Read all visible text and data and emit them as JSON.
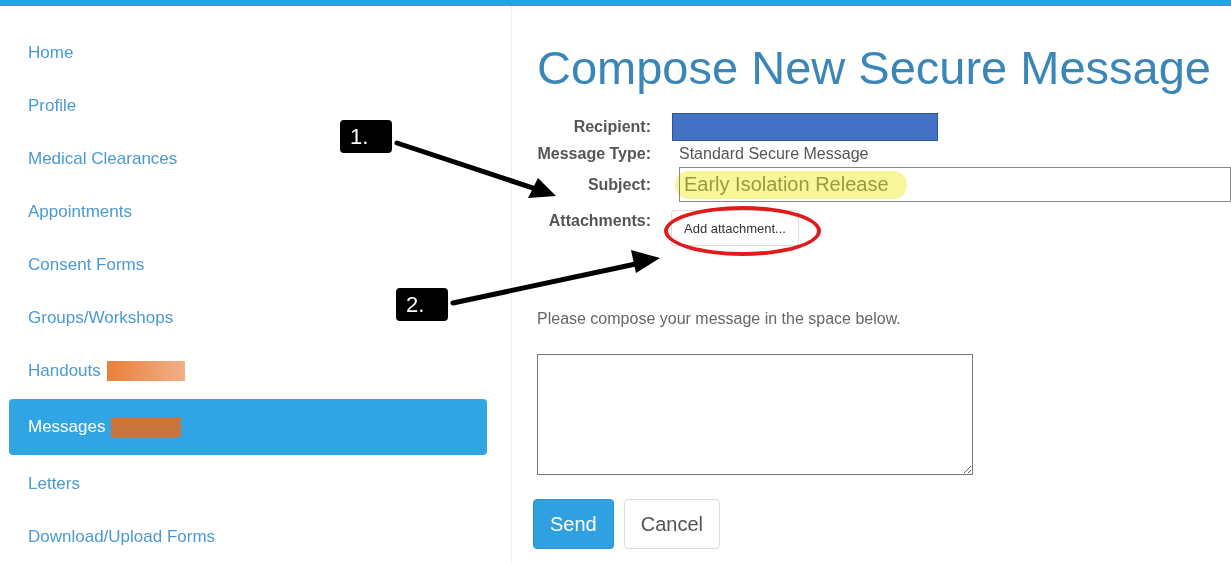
{
  "sidebar": {
    "items": [
      {
        "label": "Home",
        "selected": false,
        "redacted": false
      },
      {
        "label": "Profile",
        "selected": false,
        "redacted": false
      },
      {
        "label": "Medical Clearances",
        "selected": false,
        "redacted": false
      },
      {
        "label": "Appointments",
        "selected": false,
        "redacted": false
      },
      {
        "label": "Consent Forms",
        "selected": false,
        "redacted": false
      },
      {
        "label": "Groups/Workshops",
        "selected": false,
        "redacted": false
      },
      {
        "label": "Handouts",
        "selected": false,
        "redacted": true
      },
      {
        "label": "Messages",
        "selected": true,
        "redacted": true
      },
      {
        "label": "Letters",
        "selected": false,
        "redacted": false
      },
      {
        "label": "Download/Upload Forms",
        "selected": false,
        "redacted": false
      }
    ]
  },
  "page_title": "Compose New Secure Message",
  "form": {
    "recipient": {
      "label": "Recipient:",
      "redacted": true
    },
    "message_type": {
      "label": "Message Type:",
      "value": "Standard Secure Message"
    },
    "subject": {
      "label": "Subject:",
      "value": "Early Isolation Release",
      "highlighted": true
    },
    "attachments": {
      "label": "Attachments:",
      "button": "Add attachment...",
      "circled": true
    },
    "prompt": "Please compose your message in the space below.",
    "buttons": [
      {
        "label": "Send",
        "kind": "primary"
      },
      {
        "label": "Cancel",
        "kind": "default"
      }
    ]
  },
  "annotations": [
    {
      "label": "1."
    },
    {
      "label": "2."
    }
  ]
}
